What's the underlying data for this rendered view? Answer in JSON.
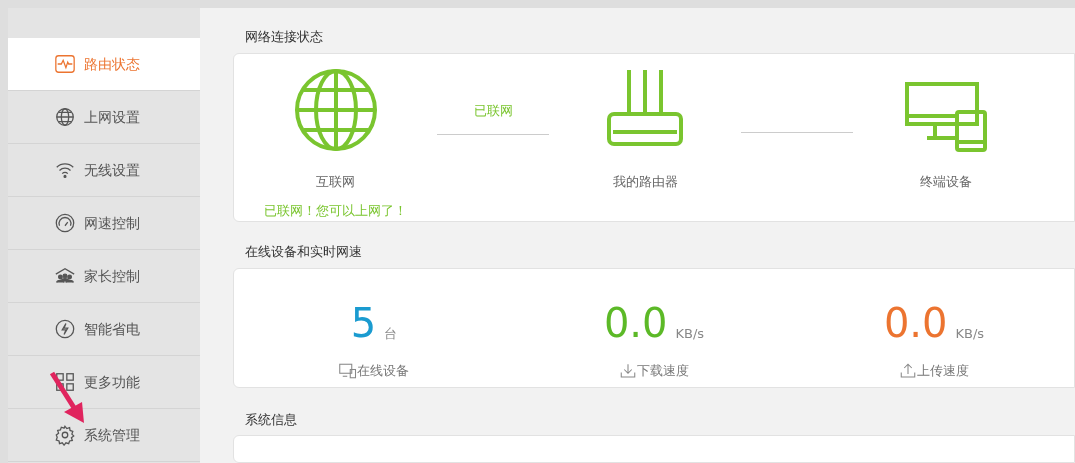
{
  "sidebar": {
    "items": [
      {
        "label": "路由状态",
        "selected": true
      },
      {
        "label": "上网设置",
        "selected": false
      },
      {
        "label": "无线设置",
        "selected": false
      },
      {
        "label": "网速控制",
        "selected": false
      },
      {
        "label": "家长控制",
        "selected": false
      },
      {
        "label": "智能省电",
        "selected": false
      },
      {
        "label": "更多功能",
        "selected": false
      },
      {
        "label": "系统管理",
        "selected": false
      }
    ]
  },
  "network_status": {
    "title": "网络连接状态",
    "internet_label": "互联网",
    "link_status": "已联网",
    "router_label": "我的路由器",
    "devices_label": "终端设备",
    "message": "已联网！您可以上网了！"
  },
  "realtime": {
    "title": "在线设备和实时网速",
    "stats": [
      {
        "value": "5",
        "unit": "台",
        "label": "在线设备",
        "color": "#1a9bd0"
      },
      {
        "value": "0.0",
        "unit": "KB/s",
        "label": "下载速度",
        "color": "#5cb927"
      },
      {
        "value": "0.0",
        "unit": "KB/s",
        "label": "上传速度",
        "color": "#ec7430"
      }
    ]
  },
  "system_info": {
    "title": "系统信息"
  }
}
